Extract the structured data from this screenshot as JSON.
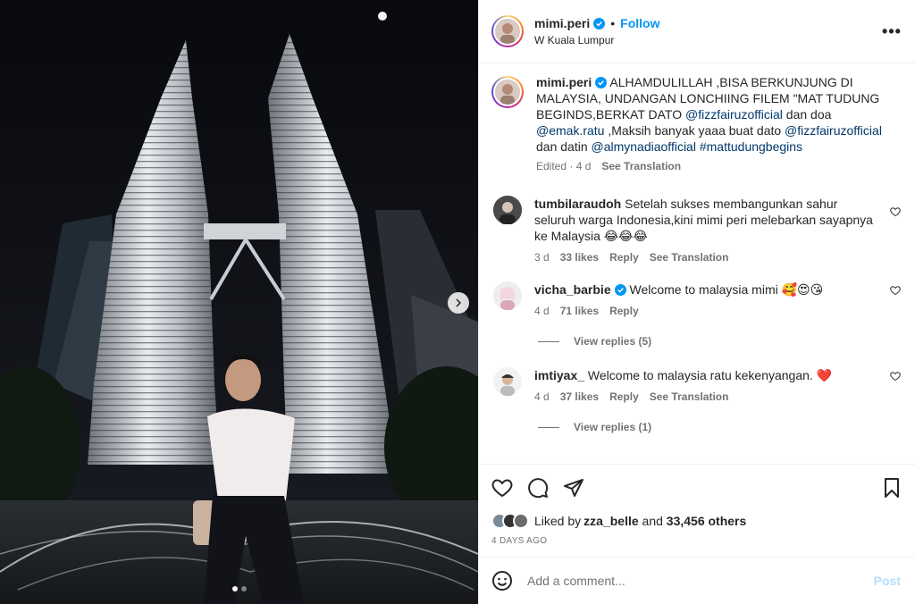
{
  "post": {
    "username": "mimi.peri",
    "follow_label": "Follow",
    "separator": "•",
    "location": "W Kuala Lumpur",
    "more_label": "•••"
  },
  "caption": {
    "username": "mimi.peri",
    "text1": " ALHAMDULILLAH ,BISA BERKUNJUNG DI MALAYSIA, UNDANGAN LONCHIING FILEM \"MAT TUDUNG BEGINDS,BERKAT DATO ",
    "mention1": "@fizzfairuzofficial",
    "text2": " dan doa ",
    "mention2": "@emak.ratu",
    "text3": " ,Maksih banyak yaaa buat dato ",
    "mention3": "@fizzfairuzofficial",
    "text4": " dan datin ",
    "mention4": "@almynadiaofficial",
    "text5": " ",
    "hashtag": "#mattudungbegins",
    "edited": "Edited · 4 d",
    "see_translation": "See Translation"
  },
  "comments": [
    {
      "username": "tumbilaraudoh",
      "text": " Setelah sukses membangunkan sahur seluruh warga Indonesia,kini mimi peri melebarkan sayapnya ke Malaysia 😂😂😂",
      "time": "3 d",
      "likes": "33 likes",
      "reply": "Reply",
      "see_translation": "See Translation"
    },
    {
      "username": "vicha_barbie",
      "text": " Welcome to malaysia mimi 🥰😍😘",
      "time": "4 d",
      "likes": "71 likes",
      "reply": "Reply",
      "view_replies": "View replies (5)"
    },
    {
      "username": "imtiyax_",
      "text": " Welcome to malaysia ratu kekenyangan. ❤️",
      "time": "4 d",
      "likes": "37 likes",
      "reply": "Reply",
      "see_translation": "See Translation",
      "view_replies": "View replies (1)"
    }
  ],
  "likes": {
    "prefix": "Liked by ",
    "user": "zza_belle",
    "middle": " and ",
    "count": "33,456 others"
  },
  "date": "4 DAYS AGO",
  "add_comment": {
    "placeholder": "Add a comment...",
    "post_label": "Post"
  },
  "colors": {
    "link": "#00376b",
    "follow": "#0095f6",
    "verified": "#0095f6",
    "muted": "#737373"
  }
}
